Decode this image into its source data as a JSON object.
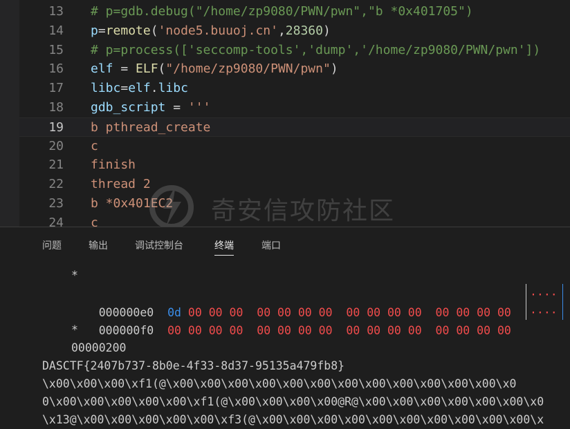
{
  "editor": {
    "lines": [
      {
        "num": "13",
        "tokens": [
          {
            "t": "# p=gdb.debug(\"/home/zp9080/PWN/pwn\",\"b *0x401705\")",
            "c": "c-comment"
          }
        ]
      },
      {
        "num": "14",
        "tokens": [
          {
            "t": "p",
            "c": "c-var"
          },
          {
            "t": "=",
            "c": "c-plain"
          },
          {
            "t": "remote",
            "c": "c-func"
          },
          {
            "t": "(",
            "c": "c-plain"
          },
          {
            "t": "'node5.buuoj.cn'",
            "c": "c-str"
          },
          {
            "t": ",",
            "c": "c-plain"
          },
          {
            "t": "28360",
            "c": "c-num"
          },
          {
            "t": ")",
            "c": "c-plain"
          }
        ]
      },
      {
        "num": "15",
        "tokens": [
          {
            "t": "# p=process(['seccomp-tools','dump','/home/zp9080/PWN/pwn'])",
            "c": "c-comment"
          }
        ]
      },
      {
        "num": "16",
        "tokens": [
          {
            "t": "elf",
            "c": "c-var"
          },
          {
            "t": " = ",
            "c": "c-plain"
          },
          {
            "t": "ELF",
            "c": "c-func"
          },
          {
            "t": "(",
            "c": "c-plain"
          },
          {
            "t": "\"/home/zp9080/PWN/pwn\"",
            "c": "c-str"
          },
          {
            "t": ")",
            "c": "c-plain"
          }
        ]
      },
      {
        "num": "17",
        "tokens": [
          {
            "t": "libc",
            "c": "c-var"
          },
          {
            "t": "=",
            "c": "c-plain"
          },
          {
            "t": "elf",
            "c": "c-var"
          },
          {
            "t": ".",
            "c": "c-plain"
          },
          {
            "t": "libc",
            "c": "c-var"
          }
        ]
      },
      {
        "num": "18",
        "tokens": [
          {
            "t": "gdb_script",
            "c": "c-var"
          },
          {
            "t": " = ",
            "c": "c-plain"
          },
          {
            "t": "'''",
            "c": "c-str"
          }
        ]
      },
      {
        "num": "19",
        "current": true,
        "tokens": [
          {
            "t": "b pthread_create",
            "c": "c-str"
          }
        ]
      },
      {
        "num": "20",
        "tokens": [
          {
            "t": "c",
            "c": "c-str"
          }
        ]
      },
      {
        "num": "21",
        "tokens": [
          {
            "t": "finish",
            "c": "c-str"
          }
        ]
      },
      {
        "num": "22",
        "tokens": [
          {
            "t": "thread 2",
            "c": "c-str"
          }
        ]
      },
      {
        "num": "23",
        "tokens": [
          {
            "t": "b *0x401EC2",
            "c": "c-str"
          }
        ]
      },
      {
        "num": "24",
        "tokens": [
          {
            "t": "c",
            "c": "c-str"
          }
        ]
      }
    ]
  },
  "watermark": {
    "text": "奇安信攻防社区"
  },
  "panel": {
    "tabs": [
      {
        "label": "问题",
        "active": false
      },
      {
        "label": "输出",
        "active": false
      },
      {
        "label": "调试控制台",
        "active": false
      },
      {
        "label": "终端",
        "active": true
      },
      {
        "label": "端口",
        "active": false
      }
    ],
    "terminal": {
      "star1": "*",
      "hex_rows": [
        {
          "addr": "000000e0",
          "first": "0d",
          "rest": " 00 00 00  00 00 00 00  00 00 00 00  00 00 00 00",
          "ascii": "····",
          "first_blue": true
        },
        {
          "addr": "000000f0",
          "first": "00",
          "rest": " 00 00 00  00 00 00 00  00 00 00 00  00 00 00 00",
          "ascii": "····",
          "first_blue": false
        }
      ],
      "star2": "*",
      "end_addr": "00000200",
      "flag": "DASCTF{2407b737-8b0e-4f33-8d37-95135a479fb8}",
      "dump1": "\\x00\\x00\\x00\\xf1(@\\x00\\x00\\x00\\x00\\x00\\x00\\x00\\x00\\x00\\x00\\x00\\x00\\x0",
      "dump2": "0\\x00\\x00\\x00\\x00\\x00\\xf1(@\\x00\\x00\\x00\\x00@R@\\x00\\x00\\x00\\x00\\x00\\x00\\x0",
      "dump3": "\\x13@\\x00\\x00\\x00\\x00\\x00\\xf3(@\\x00\\x00\\x00\\x00\\x00\\x00\\x00\\x00\\x00\\x00\\x"
    }
  },
  "colors": {
    "background": "#1e1e1e",
    "comment": "#6a9955",
    "string": "#ce9178",
    "variable": "#9cdcfe",
    "function": "#dcdcaa",
    "number": "#b5cea8",
    "hex_red": "#f14c4c",
    "hex_blue": "#3b8eea"
  }
}
